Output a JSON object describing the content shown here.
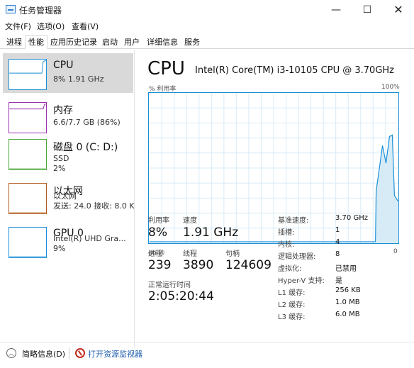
{
  "window": {
    "title": "任务管理器",
    "controls": {
      "minimize": "—",
      "maximize": "☐",
      "close": "✕"
    }
  },
  "menu": [
    "文件(F)",
    "选项(O)",
    "查看(V)"
  ],
  "tabs": [
    "进程",
    "性能",
    "应用历史记录",
    "启动",
    "用户",
    "详细信息",
    "服务"
  ],
  "active_tab": "性能",
  "sidebar": {
    "items": [
      {
        "name": "CPU",
        "lines": [
          "8% 1.91 GHz"
        ],
        "color": "#1b8fd6",
        "selected": true
      },
      {
        "name": "内存",
        "lines": [
          "6.6/7.7 GB (86%)"
        ],
        "color": "#9b2fb0"
      },
      {
        "name": "磁盘 0 (C: D:)",
        "lines": [
          "SSD",
          "2%"
        ],
        "color": "#4ba83a"
      },
      {
        "name": "以太网",
        "lines": [
          "以太网",
          "发送: 24.0  接收: 8.0 Kb"
        ],
        "color": "#b25a1e"
      },
      {
        "name": "GPU 0",
        "lines": [
          "Intel(R) UHD Gra...",
          "9%"
        ],
        "color": "#1b8fd6"
      }
    ]
  },
  "main": {
    "title": "CPU",
    "model": "Intel(R) Core(TM) i3-10105 CPU @ 3.70GHz",
    "graph_left_label": "% 利用率",
    "graph_right_label": "100%",
    "graph_time_left": "60 秒",
    "graph_time_right": "0",
    "graph_color": "#1b8fd6",
    "utilization_label": "利用率",
    "utilization": "8%",
    "speed_label": "速度",
    "speed": "1.91 GHz",
    "processes_label": "进程",
    "processes": "239",
    "threads_label": "线程",
    "threads": "3890",
    "handles_label": "句柄",
    "handles": "124609",
    "uptime_label": "正常运行时间",
    "uptime": "2:05:20:44",
    "details": [
      {
        "label": "基准速度:",
        "value": "3.70 GHz"
      },
      {
        "label": "插槽:",
        "value": "1"
      },
      {
        "label": "内核:",
        "value": "4"
      },
      {
        "label": "逻辑处理器:",
        "value": "8"
      },
      {
        "label": "虚拟化:",
        "value": "已禁用"
      },
      {
        "label": "Hyper-V 支持:",
        "value": "是"
      },
      {
        "label": "L1 缓存:",
        "value": "256 KB"
      },
      {
        "label": "L2 缓存:",
        "value": "1.0 MB"
      },
      {
        "label": "L3 缓存:",
        "value": "6.0 MB"
      }
    ]
  },
  "footer": {
    "fewer_details": "简略信息(D)",
    "resource_monitor": "打开资源监视器"
  }
}
